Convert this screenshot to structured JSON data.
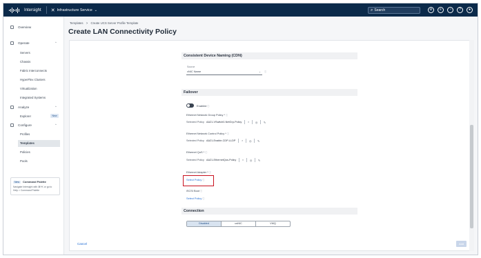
{
  "app": {
    "brand": "Intersight",
    "service": "Infrastructure Service"
  },
  "search": {
    "placeholder": "Search"
  },
  "sidebar": {
    "items": [
      {
        "label": "Overview",
        "icon": "overview-icon"
      },
      {
        "label": "Operate",
        "icon": "operate-icon"
      },
      {
        "label": "Servers"
      },
      {
        "label": "Chassis"
      },
      {
        "label": "Fabric Interconnects"
      },
      {
        "label": "HyperFlex Clusters"
      },
      {
        "label": "Virtualization"
      },
      {
        "label": "Integrated Systems"
      },
      {
        "label": "Analyze",
        "icon": "analyze-icon"
      },
      {
        "label": "Explorer",
        "badge": "New"
      },
      {
        "label": "Configure",
        "icon": "configure-icon"
      },
      {
        "label": "Profiles"
      },
      {
        "label": "Templates"
      },
      {
        "label": "Policies"
      },
      {
        "label": "Pools"
      }
    ],
    "palette": {
      "badge": "New",
      "title": "Command Palette",
      "desc": "Navigate Intersight with ⌘+K or go to Help > Command Palette"
    }
  },
  "breadcrumb": {
    "one": "Templates",
    "sep": ">",
    "two": "Create UCS Server Profile Template"
  },
  "page_title": "Create LAN Connectivity Policy",
  "cdn": {
    "section": "Consistent Device Naming (CDN)",
    "source_label": "Source",
    "source_value": "vNIC Name"
  },
  "failover": {
    "section": "Failover",
    "enabled_label": "Enabled",
    "group_label": "Ethernet Network Group Policy *",
    "group_selected": "Selected Policy",
    "group_value": "AA21-VSwitch0-NetGrp-Policy",
    "control_label": "Ethernet Network Control Policy *",
    "control_selected": "Selected Policy",
    "control_value": "AA21-Enable-CDP-LLDP",
    "qos_label": "Ethernet QoS *",
    "qos_selected": "Selected Policy",
    "qos_value": "AA21-EthernetQos-Policy",
    "adapter_label": "Ethernet Adapter *",
    "adapter_link": "Select Policy",
    "iscsi_label": "iSCSI Boot",
    "iscsi_link": "Select Policy"
  },
  "connection": {
    "section": "Connection",
    "options": [
      "Disabled",
      "usNIC",
      "VMQ"
    ],
    "selected": "Disabled"
  },
  "footer": {
    "cancel": "Cancel",
    "add": "Add"
  },
  "colors": {
    "topbar": "#0b2a4a",
    "link": "#1d6ad3",
    "highlight": "#c8101e"
  }
}
